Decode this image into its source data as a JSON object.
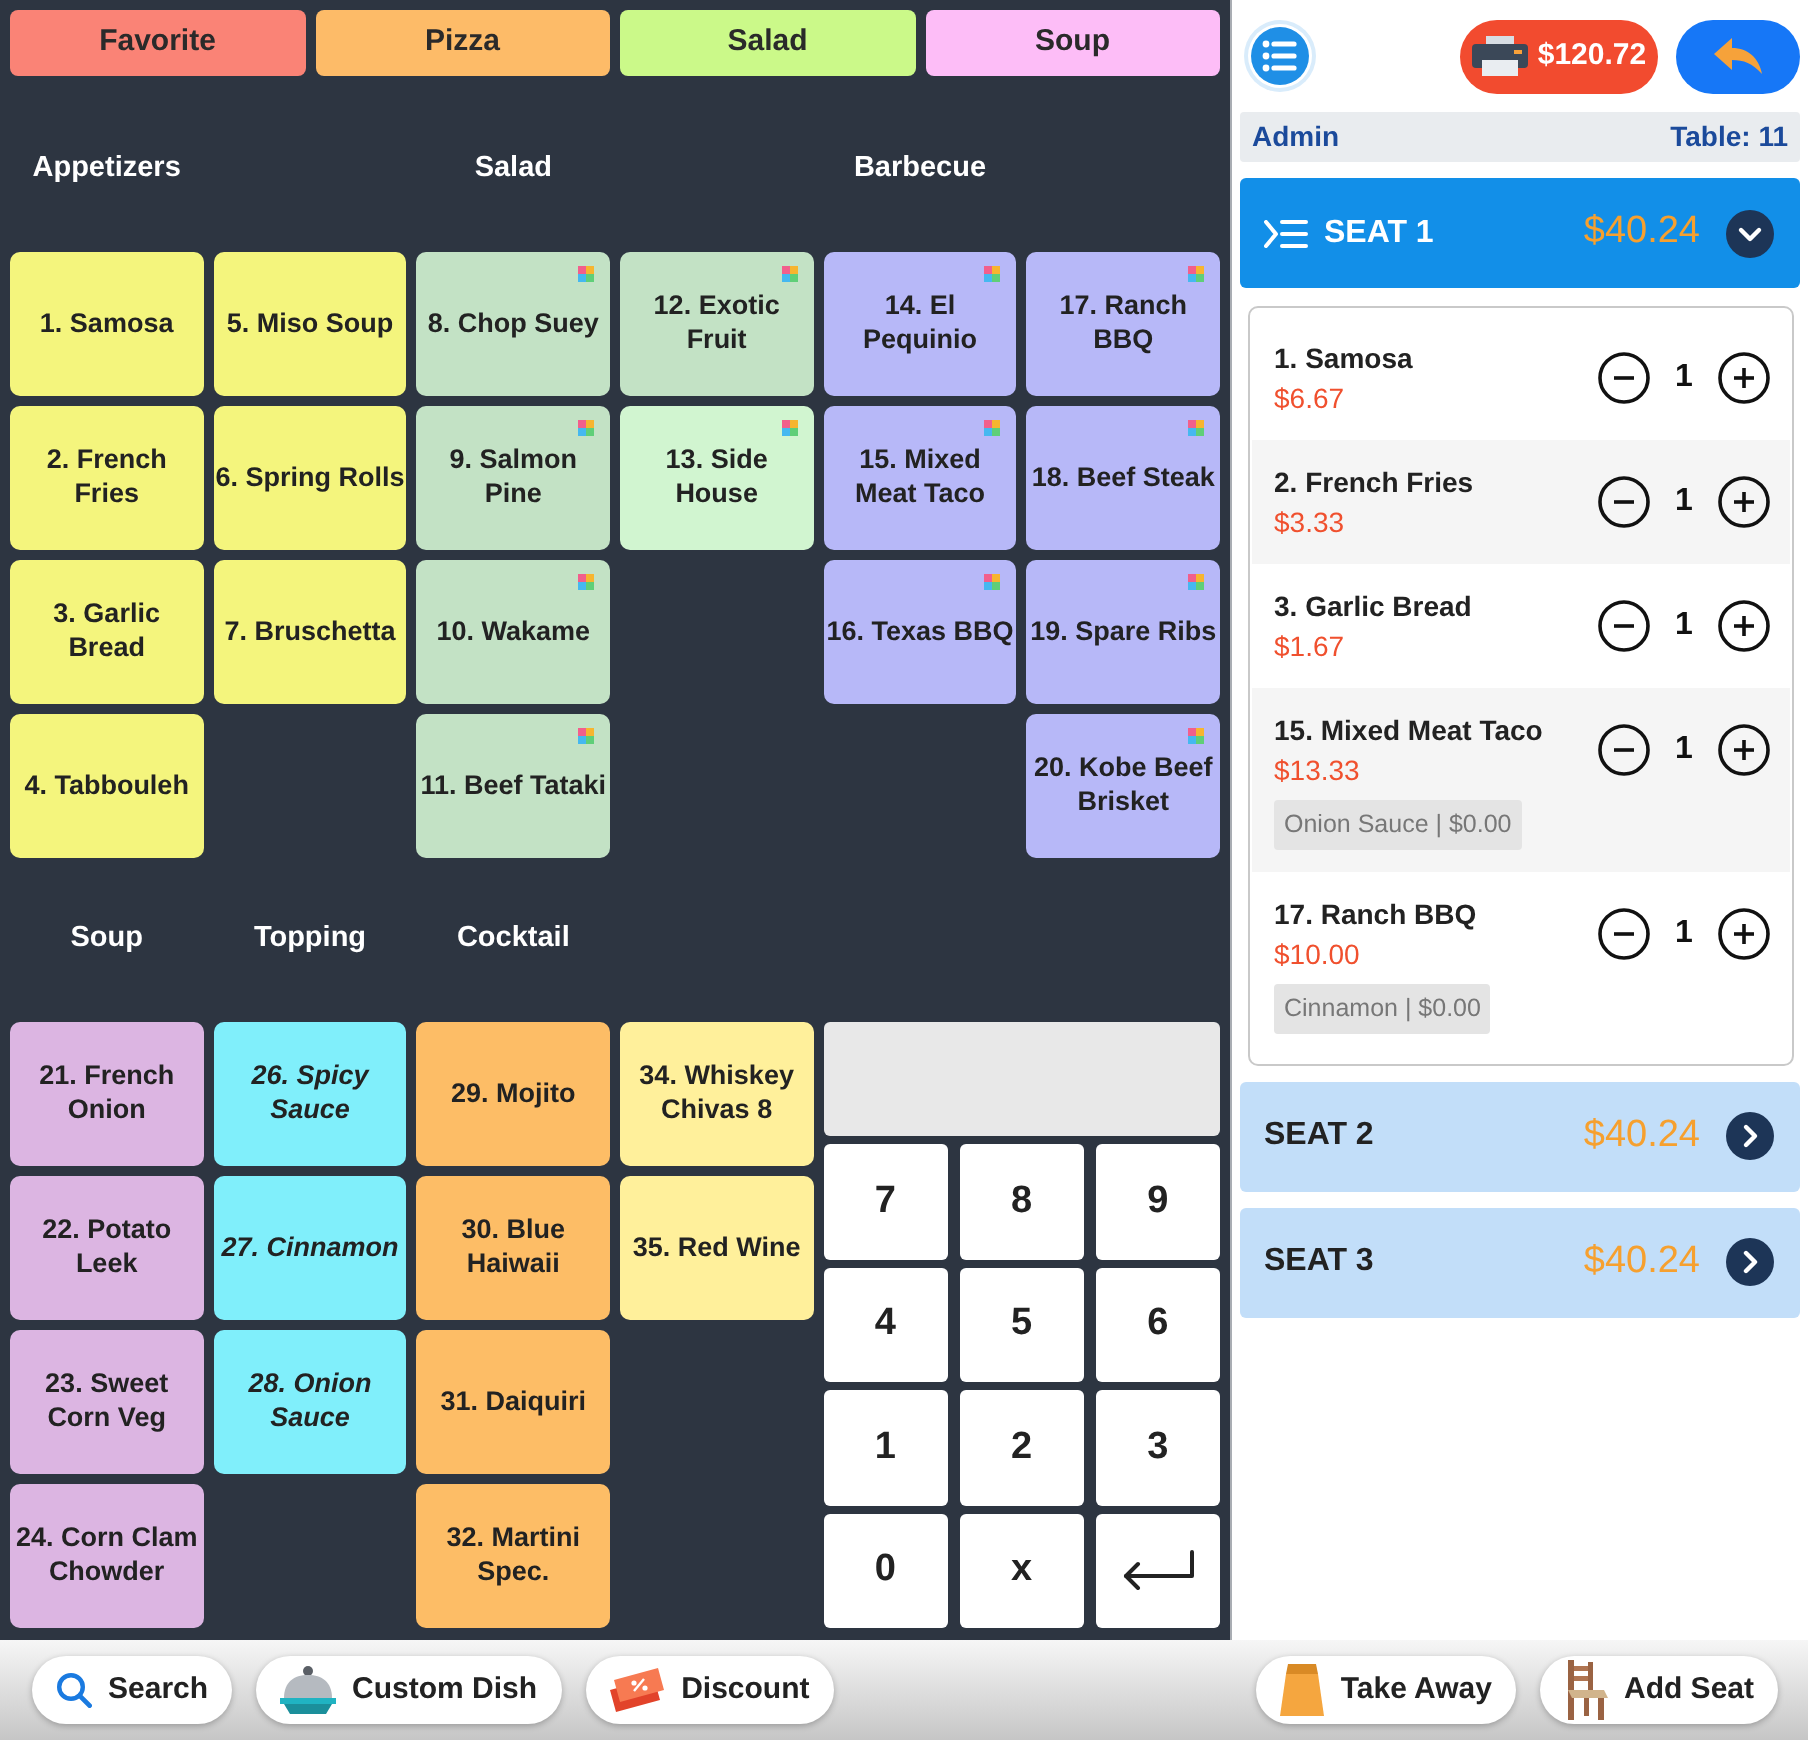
{
  "category_tabs": [
    {
      "label": "Favorite",
      "color": "#fa8376",
      "selected": false
    },
    {
      "label": "Pizza",
      "color": "#fdbb68",
      "selected": false
    },
    {
      "label": "Salad",
      "color": "#cbf989",
      "selected": false
    },
    {
      "label": "Soup",
      "color": "#fdbdf7",
      "selected": false
    }
  ],
  "menu_blocks": [
    {
      "sections": [
        {
          "title": "Appetizers",
          "kind": "dish",
          "columns": [
            [
              {
                "label": "1. Samosa",
                "color": "#f4f57d",
                "has_options": false
              },
              {
                "label": "2. French Fries",
                "color": "#f4f57d",
                "has_options": false
              },
              {
                "label": "3. Garlic Bread",
                "color": "#f4f57d",
                "has_options": false
              },
              {
                "label": "4. Tabbouleh",
                "color": "#f4f57d",
                "has_options": false
              }
            ],
            [
              {
                "label": "5. Miso Soup",
                "color": "#f4f57d",
                "has_options": false
              },
              {
                "label": "6. Spring Rolls",
                "color": "#f4f57d",
                "has_options": false
              },
              {
                "label": "7. Bruschetta",
                "color": "#f4f57d",
                "has_options": false
              }
            ]
          ]
        },
        {
          "title": "Salad",
          "kind": "dish",
          "columns": [
            [
              {
                "label": "8. Chop Suey",
                "color": "#c3e2c5",
                "has_options": true
              },
              {
                "label": "9. Salmon Pine",
                "color": "#c3e2c5",
                "has_options": true
              },
              {
                "label": "10. Wakame",
                "color": "#c3e2c5",
                "has_options": true
              },
              {
                "label": "11. Beef Tataki",
                "color": "#c3e2c5",
                "has_options": true
              }
            ],
            [
              {
                "label": "12. Exotic Fruit",
                "color": "#c3e2c5",
                "has_options": true
              },
              {
                "label": "13. Side House",
                "color": "#d1f5d0",
                "has_options": true
              }
            ]
          ]
        },
        {
          "title": "Barbecue",
          "kind": "dish",
          "columns": [
            [
              {
                "label": "14. El Pequinio",
                "color": "#b7b8f8",
                "has_options": true
              },
              {
                "label": "15. Mixed Meat Taco",
                "color": "#b7b8f8",
                "has_options": true
              },
              {
                "label": "16. Texas BBQ",
                "color": "#b7b8f8",
                "has_options": true
              }
            ],
            [
              {
                "label": "17. Ranch BBQ",
                "color": "#b7b8f8",
                "has_options": true
              },
              {
                "label": "18. Beef Steak",
                "color": "#b7b8f8",
                "has_options": true
              },
              {
                "label": "19. Spare Ribs",
                "color": "#b7b8f8",
                "has_options": true
              },
              {
                "label": "20. Kobe Beef Brisket",
                "color": "#b7b8f8",
                "has_options": true
              }
            ]
          ]
        }
      ]
    },
    {
      "sections": [
        {
          "title": "Soup",
          "kind": "dish",
          "columns": [
            [
              {
                "label": "21. French Onion",
                "color": "#dcb5e2",
                "has_options": false
              },
              {
                "label": "22. Potato Leek",
                "color": "#dcb5e2",
                "has_options": false
              },
              {
                "label": "23. Sweet Corn Veg",
                "color": "#dcb5e2",
                "has_options": false
              },
              {
                "label": "24. Corn Clam Chowder",
                "color": "#dcb5e2",
                "has_options": false
              }
            ]
          ]
        },
        {
          "title": "Topping",
          "kind": "topping",
          "columns": [
            [
              {
                "label": "26. Spicy Sauce",
                "color": "#80effb",
                "has_options": false
              },
              {
                "label": "27. Cinnamon",
                "color": "#80effb",
                "has_options": false
              },
              {
                "label": "28. Onion Sauce",
                "color": "#80effb",
                "has_options": false
              }
            ]
          ]
        },
        {
          "title": "Cocktail",
          "kind": "dish",
          "columns": [
            [
              {
                "label": "29. Mojito",
                "color": "#fdbd66",
                "has_options": false
              },
              {
                "label": "30. Blue Haiwaii",
                "color": "#fdbd66",
                "has_options": false
              },
              {
                "label": "31. Daiquiri",
                "color": "#fdbd66",
                "has_options": false
              },
              {
                "label": "32. Martini Spec.",
                "color": "#fdbd66",
                "has_options": false
              }
            ],
            [
              {
                "label": "34. Whiskey Chivas 8",
                "color": "#fff09b",
                "has_options": false
              },
              {
                "label": "35. Red Wine",
                "color": "#fff09b",
                "has_options": false
              }
            ]
          ]
        }
      ]
    }
  ],
  "numpad": {
    "keys": [
      "7",
      "8",
      "9",
      "4",
      "5",
      "6",
      "1",
      "2",
      "3",
      "0",
      "x"
    ]
  },
  "header": {
    "total": "$120.72"
  },
  "info_bar": {
    "user": "Admin",
    "table": "Table: 11"
  },
  "seats": [
    {
      "label": "SEAT 1",
      "total": "$40.24",
      "expanded": true,
      "items": [
        {
          "name": "1. Samosa",
          "price": "$6.67",
          "quantity": "1"
        },
        {
          "name": "2. French Fries",
          "price": "$3.33",
          "quantity": "1"
        },
        {
          "name": "3. Garlic Bread",
          "price": "$1.67",
          "quantity": "1"
        },
        {
          "name": "15. Mixed Meat Taco",
          "price": "$13.33",
          "quantity": "1",
          "modifiers": [
            "Onion Sauce | $0.00"
          ]
        },
        {
          "name": "17. Ranch BBQ",
          "price": "$10.00",
          "quantity": "1",
          "modifiers": [
            "Cinnamon | $0.00"
          ]
        }
      ]
    },
    {
      "label": "SEAT 2",
      "total": "$40.24",
      "expanded": false
    },
    {
      "label": "SEAT 3",
      "total": "$40.24",
      "expanded": false
    }
  ],
  "bottom_bar": {
    "left": [
      "Search",
      "Custom Dish",
      "Discount"
    ],
    "right": [
      "Take Away",
      "Add Seat"
    ]
  }
}
